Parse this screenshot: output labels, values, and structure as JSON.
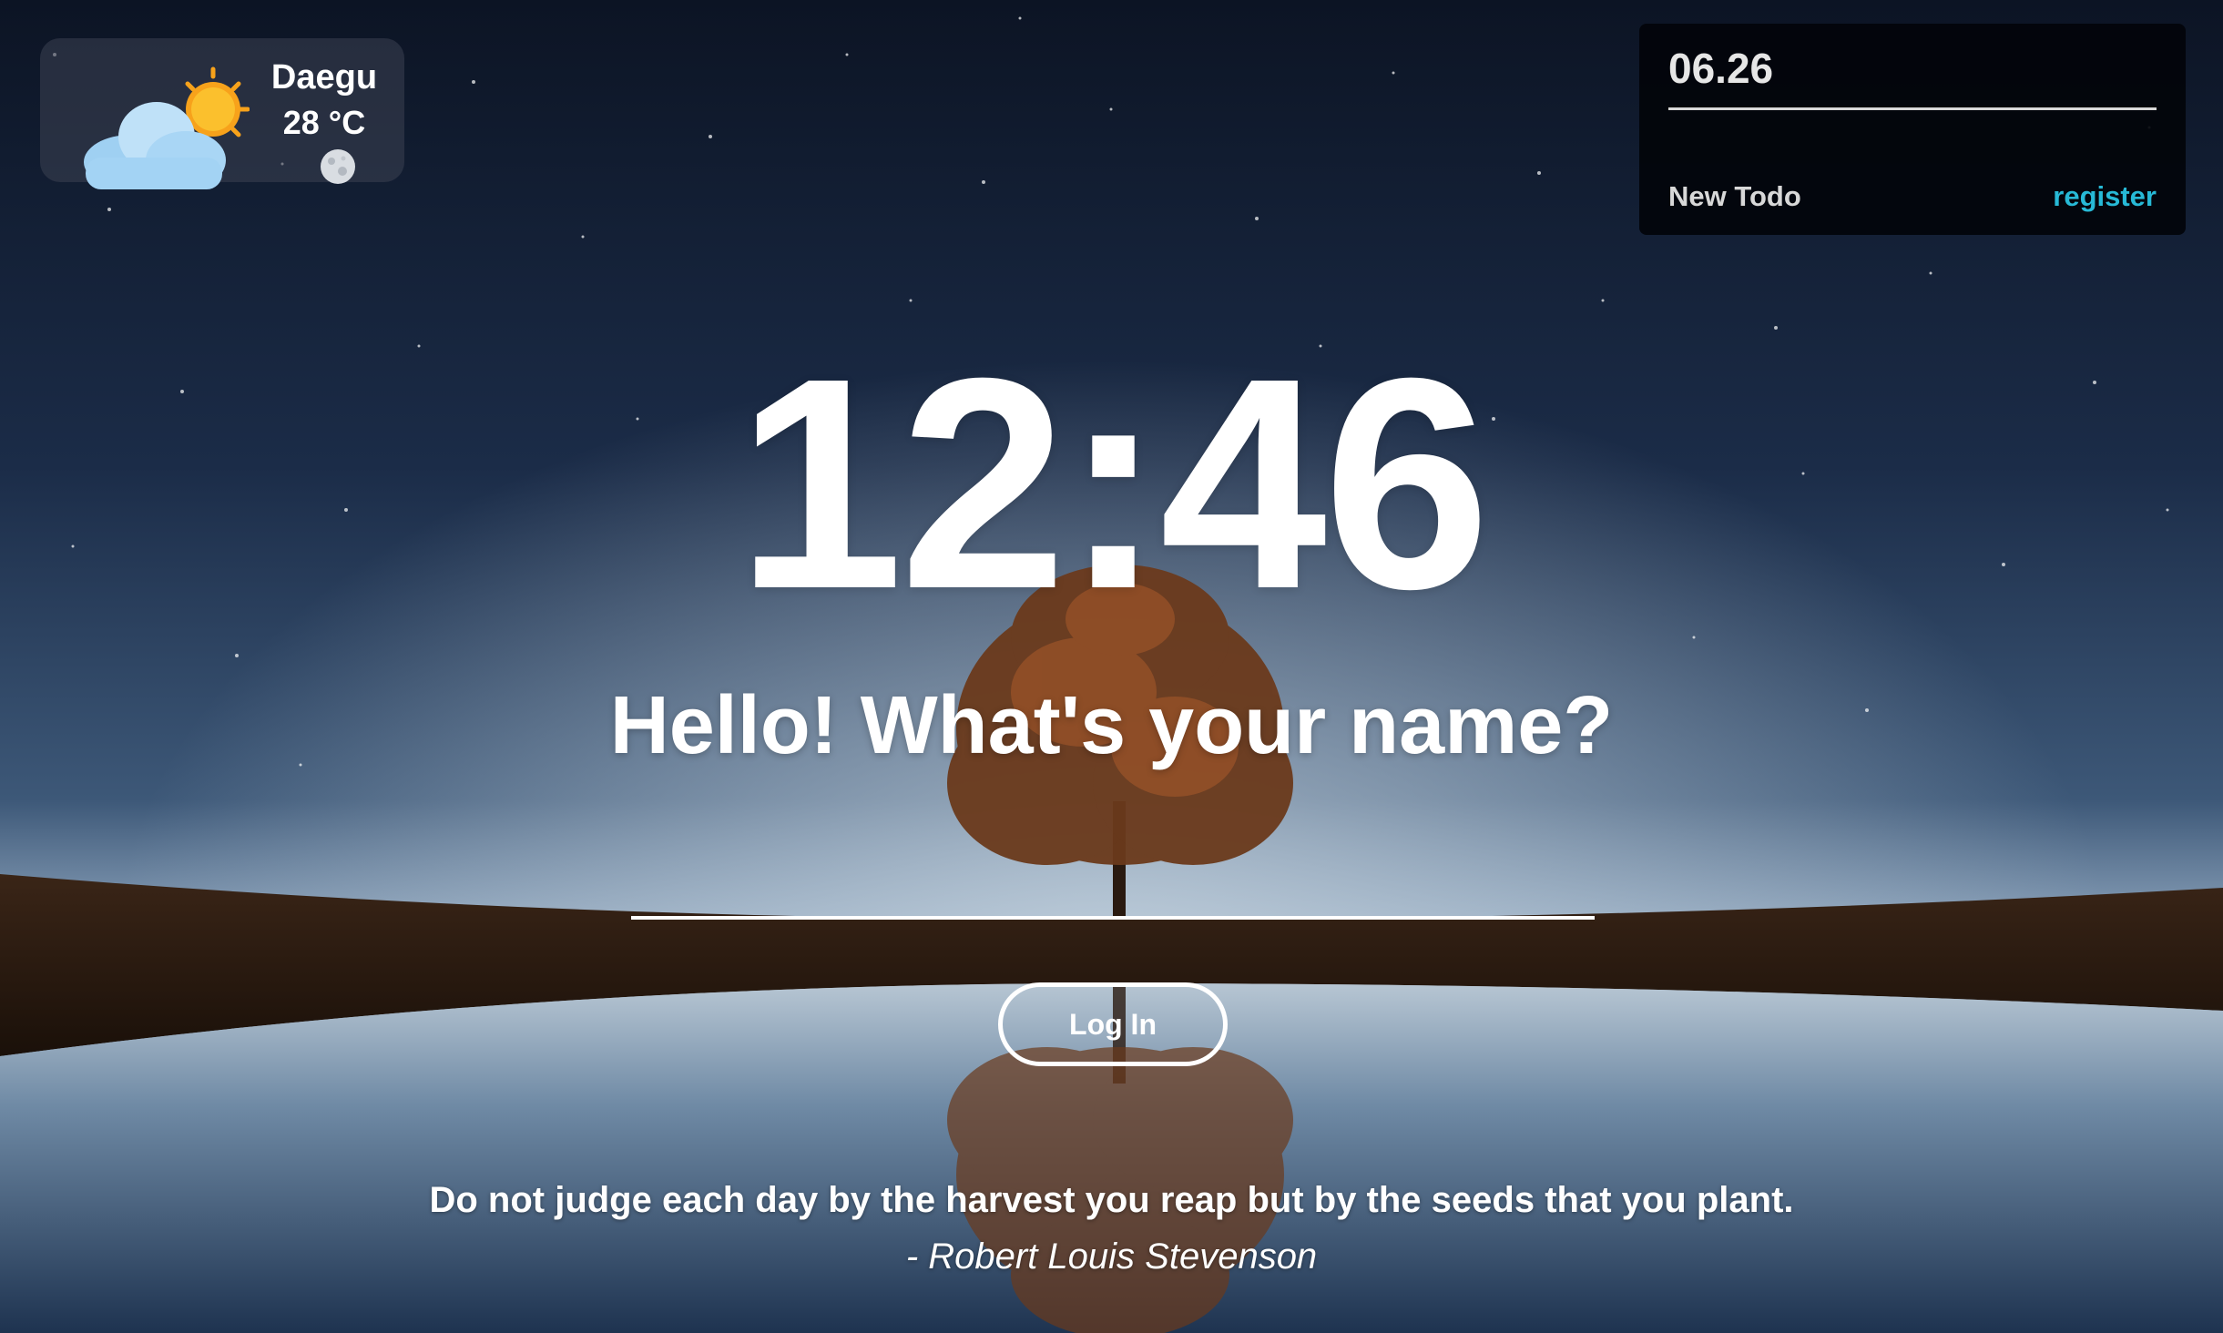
{
  "weather": {
    "city": "Daegu",
    "temperature": "28 °C",
    "icon": "partly-cloudy-day-icon",
    "moon_icon": "moon-icon"
  },
  "todo": {
    "date": "06.26",
    "new_todo_label": "New Todo",
    "register_label": "register",
    "accent_color": "#27b9d6"
  },
  "clock": {
    "time": "12:46"
  },
  "greeting": {
    "text": "Hello! What's your name?"
  },
  "login": {
    "input_value": "",
    "button_label": "Log In"
  },
  "quote": {
    "text": "Do not judge each day by the harvest you reap but by the seeds that you plant.",
    "author": "- Robert Louis Stevenson"
  },
  "background": {
    "description_icon": "night-sky-tree-lake-background"
  }
}
